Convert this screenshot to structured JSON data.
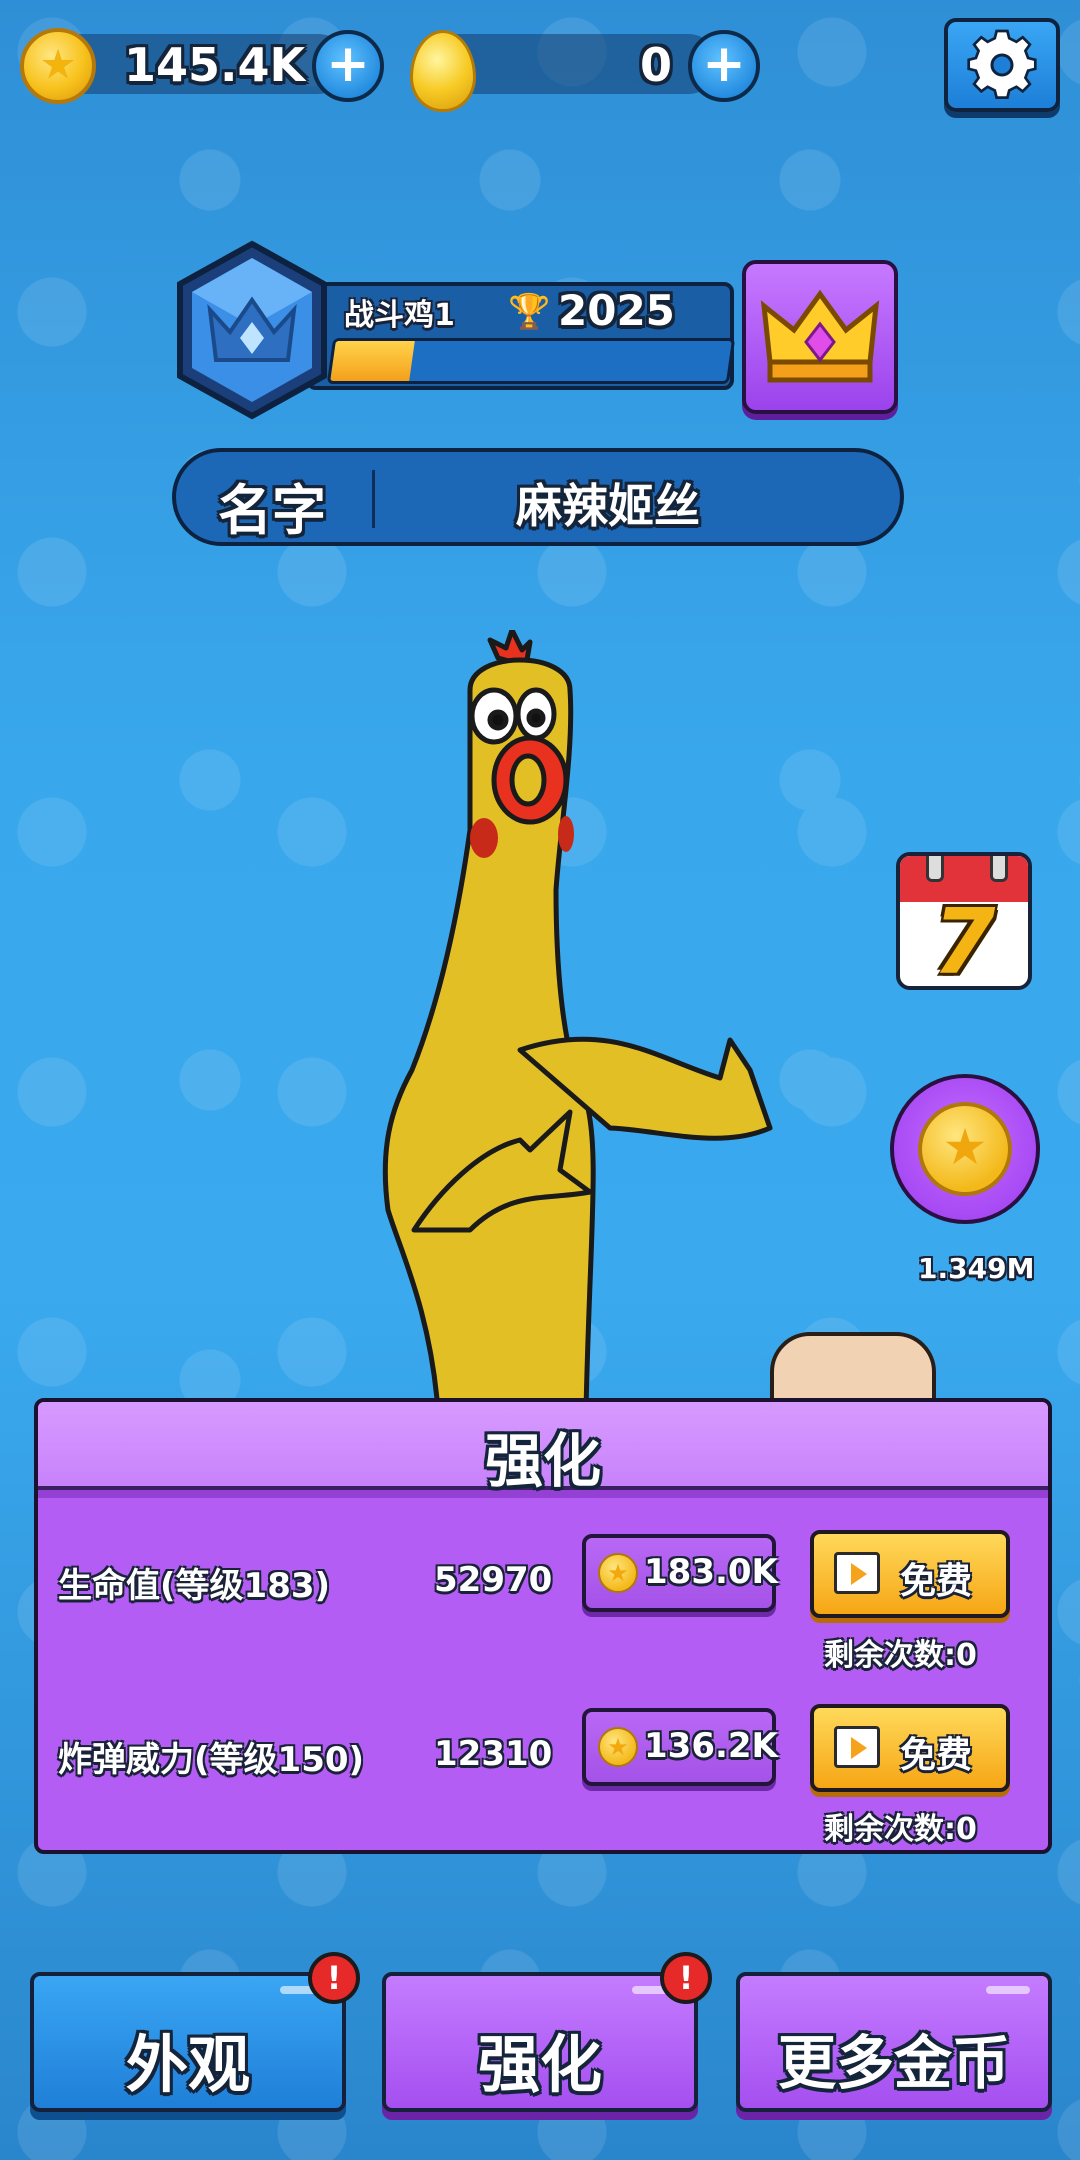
{
  "currency": {
    "coins": "145.4K",
    "gems": "0"
  },
  "profile": {
    "chicken_name": "战斗鸡1",
    "trophies": "2025",
    "xp_fraction": 0.2,
    "name_label": "名字",
    "player_name": "麻辣姬丝"
  },
  "side": {
    "calendar_day": "7",
    "coin_reward": "1.349M"
  },
  "upgrade": {
    "title": "强化",
    "rows": [
      {
        "label": "生命值(等级183)",
        "value": "52970",
        "cost": "183.0K",
        "free": "免费",
        "remaining": "剩余次数:0"
      },
      {
        "label": "炸弹威力(等级150)",
        "value": "12310",
        "cost": "136.2K",
        "free": "免费",
        "remaining": "剩余次数:0"
      }
    ]
  },
  "tabs": [
    {
      "label": "外观",
      "alert": "!"
    },
    {
      "label": "强化",
      "alert": "!"
    },
    {
      "label": "更多金币"
    }
  ],
  "colors": {
    "background": "#39a7ec",
    "panel_purple": "#b35df4",
    "tab_blue": "#2a8ee6",
    "tab_purple": "#b35df4",
    "free_yellow": "#f6a615"
  },
  "icons": {
    "settings": "gear-icon",
    "coin": "star-coin-icon",
    "gem": "golden-egg-icon",
    "crown": "crown-icon",
    "calendar": "calendar-icon"
  }
}
